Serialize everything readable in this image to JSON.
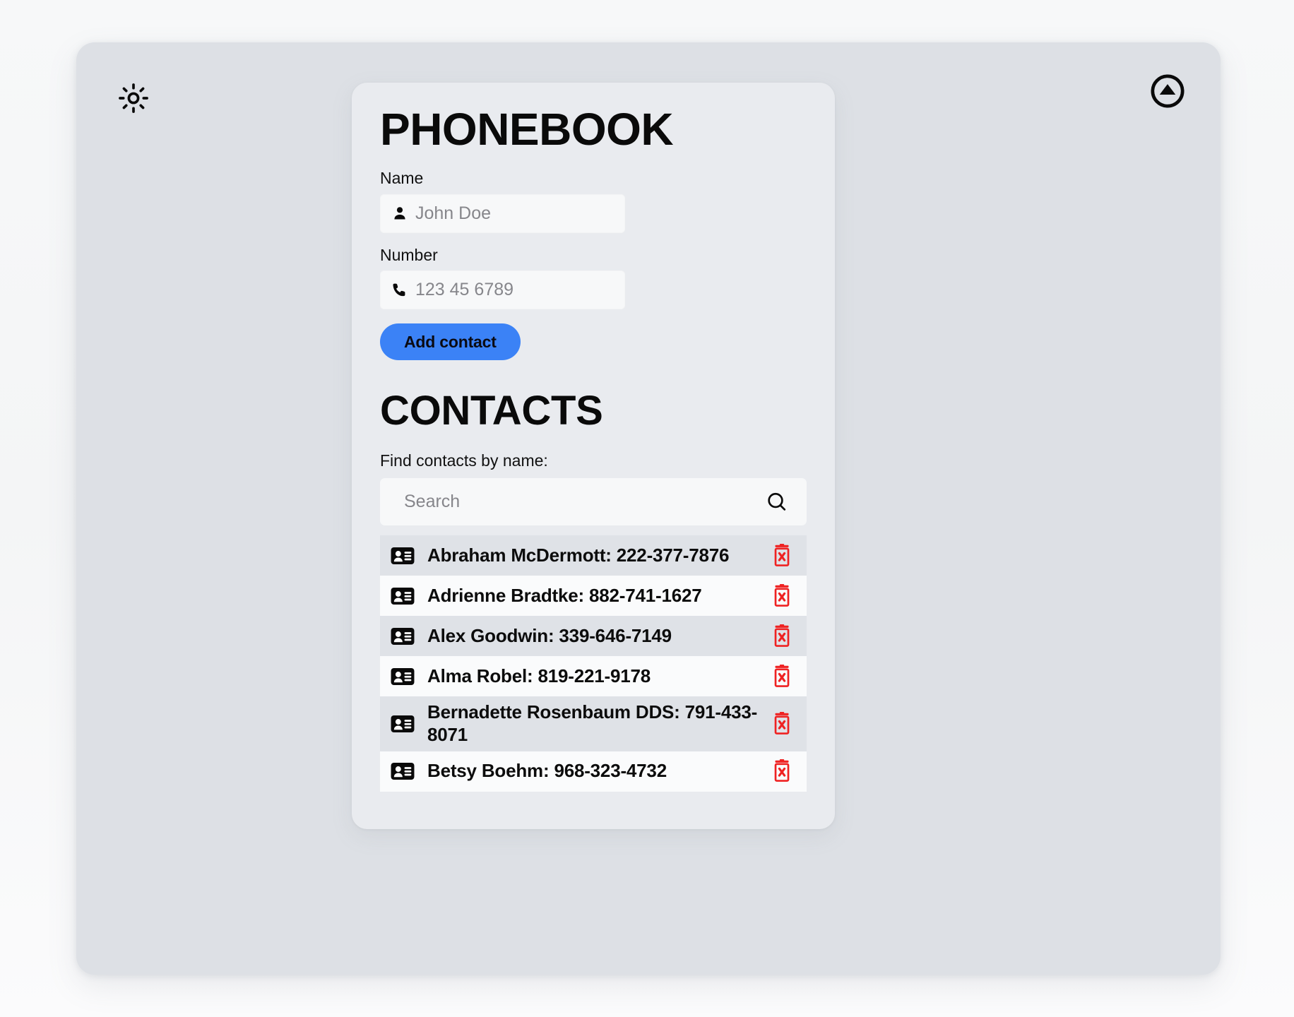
{
  "app": {
    "title": "PHONEBOOK",
    "contacts_heading": "CONTACTS"
  },
  "controls": {
    "theme_toggle_icon": "sun-icon",
    "scroll_top_icon": "circle-up-arrow-icon"
  },
  "form": {
    "name_label": "Name",
    "name_placeholder": "John Doe",
    "name_value": "",
    "name_icon": "person-icon",
    "number_label": "Number",
    "number_placeholder": "123 45 6789",
    "number_value": "",
    "number_icon": "phone-icon",
    "submit_label": "Add contact",
    "submit_color": "#3b82f6"
  },
  "search": {
    "label": "Find contacts by name:",
    "placeholder": "Search",
    "value": "",
    "icon": "search-icon"
  },
  "contacts": {
    "row_icon": "vcard-icon",
    "delete_icon": "trash-delete-icon",
    "delete_color": "#ef2222",
    "items": [
      {
        "name": "Abraham McDermott",
        "number": "222-377-7876",
        "text": "Abraham McDermott: 222-377-7876"
      },
      {
        "name": "Adrienne Bradtke",
        "number": "882-741-1627",
        "text": "Adrienne Bradtke: 882-741-1627"
      },
      {
        "name": "Alex Goodwin",
        "number": "339-646-7149",
        "text": "Alex Goodwin: 339-646-7149"
      },
      {
        "name": "Alma Robel",
        "number": "819-221-9178",
        "text": "Alma Robel: 819-221-9178"
      },
      {
        "name": "Bernadette Rosenbaum DDS",
        "number": "791-433-8071",
        "text": "Bernadette Rosenbaum DDS: 791-433-8071"
      },
      {
        "name": "Betsy Boehm",
        "number": "968-323-4732",
        "text": "Betsy Boehm: 968-323-4732"
      }
    ]
  }
}
